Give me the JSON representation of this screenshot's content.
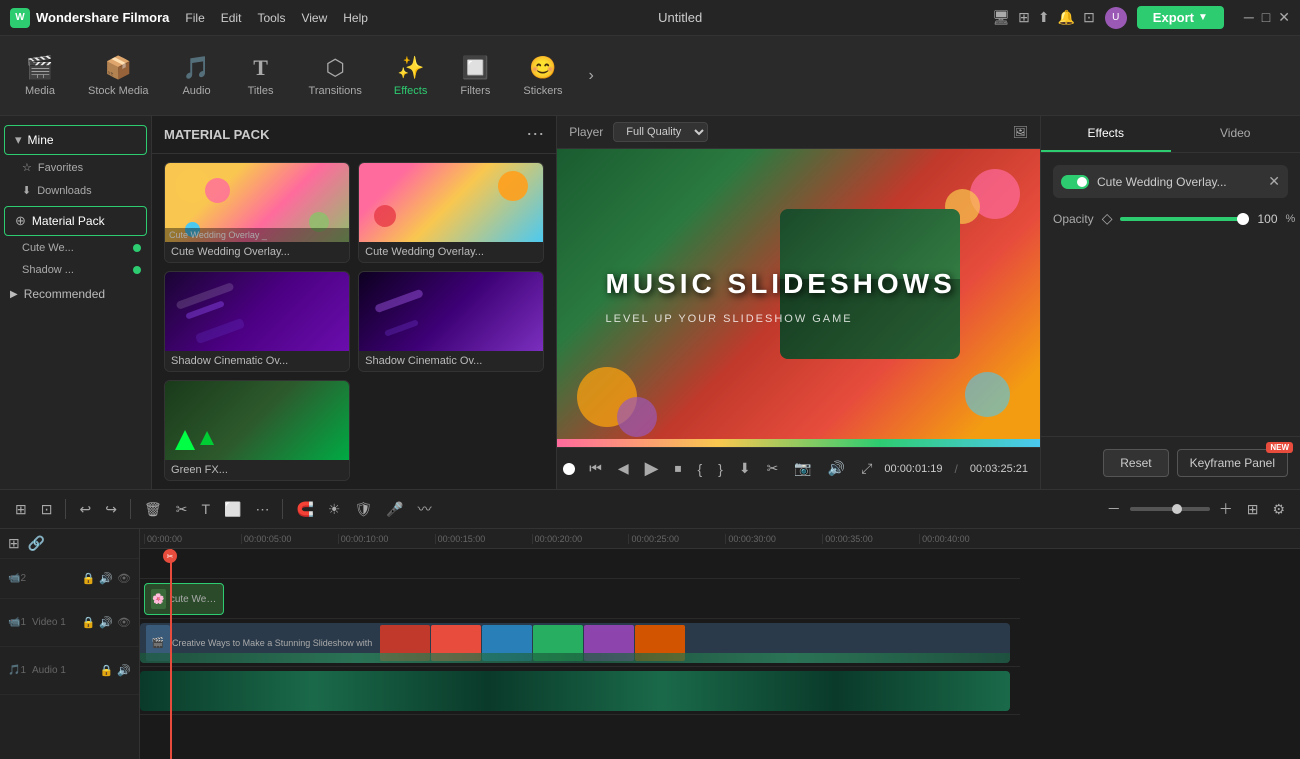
{
  "app": {
    "name": "Wondershare Filmora",
    "title": "Untitled"
  },
  "topmenu": {
    "items": [
      "File",
      "Edit",
      "Tools",
      "View",
      "Help"
    ]
  },
  "toolbar": {
    "items": [
      {
        "id": "media",
        "label": "Media",
        "icon": "🎬"
      },
      {
        "id": "stock-media",
        "label": "Stock Media",
        "icon": "📦"
      },
      {
        "id": "audio",
        "label": "Audio",
        "icon": "🎵"
      },
      {
        "id": "titles",
        "label": "Titles",
        "icon": "T"
      },
      {
        "id": "transitions",
        "label": "Transitions",
        "icon": "⬡"
      },
      {
        "id": "effects",
        "label": "Effects",
        "icon": "✨"
      },
      {
        "id": "filters",
        "label": "Filters",
        "icon": "🔲"
      },
      {
        "id": "stickers",
        "label": "Stickers",
        "icon": "😊"
      }
    ],
    "more_icon": "›"
  },
  "sidebar": {
    "sections": [
      {
        "id": "mine",
        "label": "Mine",
        "active": true,
        "children": [
          {
            "label": "Favorites",
            "icon": "☆"
          },
          {
            "label": "Downloads",
            "icon": "⬇"
          }
        ]
      },
      {
        "id": "material-pack",
        "label": "Material Pack",
        "active": true,
        "children": [
          {
            "label": "Cute We...",
            "dot": true
          },
          {
            "label": "Shadow ...",
            "dot": true
          }
        ]
      },
      {
        "id": "recommended",
        "label": "Recommended",
        "active": false
      }
    ]
  },
  "effects_panel": {
    "title": "MATERIAL PACK",
    "more_icon": "⋯",
    "cards": [
      {
        "id": "cute-wedding-1",
        "label": "Cute Wedding Overlay...",
        "thumb": "wedding1"
      },
      {
        "id": "cute-wedding-2",
        "label": "Cute Wedding Overlay...",
        "thumb": "wedding2"
      },
      {
        "id": "shadow-cinematic-1",
        "label": "Shadow Cinematic Ov...",
        "thumb": "shadow1"
      },
      {
        "id": "shadow-cinematic-2",
        "label": "Shadow Cinematic Ov...",
        "thumb": "shadow2"
      },
      {
        "id": "green-fx",
        "label": "Green FX...",
        "thumb": "green"
      }
    ]
  },
  "preview": {
    "label": "Player",
    "quality": "Full Quality",
    "video_text": "MUSIC SLIDESHOWS",
    "video_sub": "LEVEL UP YOUR SLIDESHOW GAME",
    "time_current": "00:00:01:19",
    "time_total": "00:03:25:21"
  },
  "right_panel": {
    "tabs": [
      "Effects",
      "Video"
    ],
    "active_tab": "Effects",
    "active_effect": "Cute Wedding Overlay...",
    "opacity_label": "Opacity",
    "opacity_value": "100",
    "opacity_pct": "%",
    "buttons": {
      "reset": "Reset",
      "keyframe": "Keyframe Panel",
      "new_badge": "NEW"
    }
  },
  "timeline": {
    "ruler_marks": [
      "00:00:00",
      "00:00:05:00",
      "00:00:10:00",
      "00:00:15:00",
      "00:00:20:00",
      "00:00:25:00",
      "00:00:30:00",
      "00:00:35:00",
      "00:00:40:00"
    ],
    "tracks": [
      {
        "id": "video2",
        "label": "Video 2",
        "type": "overlay"
      },
      {
        "id": "video1",
        "label": "Video 1",
        "type": "video"
      },
      {
        "id": "audio1",
        "label": "Audio 1",
        "type": "audio"
      }
    ],
    "overlay_clip": "cute Weddin...",
    "video_clip": "Creative Ways to Make a Stunning Slideshow with Music _ Mobile..."
  }
}
